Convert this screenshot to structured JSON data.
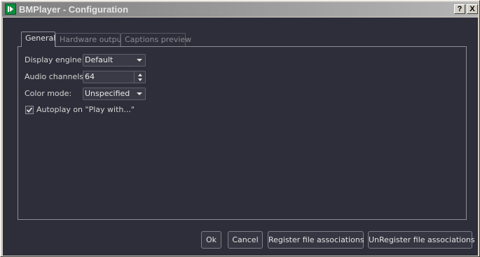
{
  "window": {
    "title": "BMPlayer - Configuration",
    "help_label": "?",
    "close_label": "X"
  },
  "tabs": [
    {
      "label": "General",
      "active": true
    },
    {
      "label": "Hardware output",
      "active": false
    },
    {
      "label": "Captions preview",
      "active": false
    }
  ],
  "general": {
    "display_engine": {
      "label": "Display engine:",
      "value": "Default"
    },
    "audio_channels": {
      "label": "Audio channels:",
      "value": "64"
    },
    "color_mode": {
      "label": "Color mode:",
      "value": "Unspecified"
    },
    "autoplay": {
      "label": "Autoplay on \"Play with...\"",
      "checked": true
    }
  },
  "buttons": {
    "ok": "Ok",
    "cancel": "Cancel",
    "register": "Register file associations",
    "unregister": "UnRegister file associations"
  },
  "icons": {
    "app": "play-icon",
    "checkbox": "check-icon"
  }
}
